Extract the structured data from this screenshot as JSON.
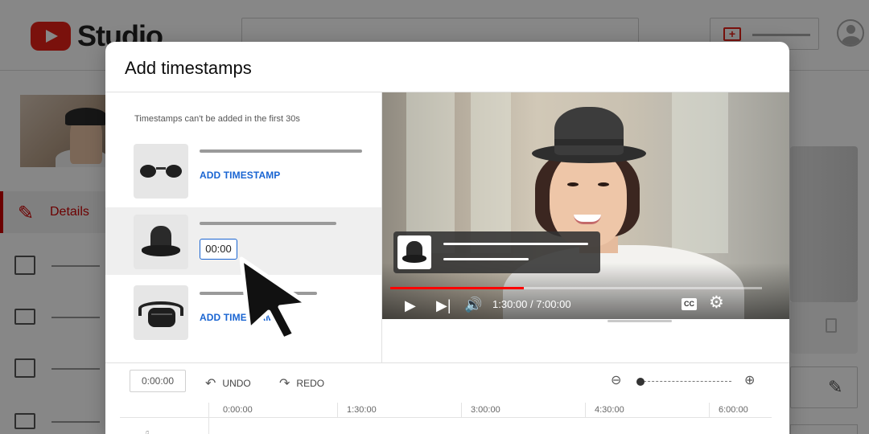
{
  "background_app": {
    "brand": "Studio",
    "nav": {
      "details_label": "Details"
    }
  },
  "modal": {
    "title": "Add timestamps",
    "hint": "Timestamps can't be added in the first 30s",
    "products": [
      {
        "icon": "sunglasses-icon",
        "action_label": "ADD TIMESTAMP"
      },
      {
        "icon": "bucket-hat-icon",
        "timestamp_value": "00:00"
      },
      {
        "icon": "waist-bag-icon",
        "action_label": "ADD TIMESTAMP"
      }
    ],
    "player": {
      "time_display": "1:30:00 / 7:00:00",
      "progress": 0.36,
      "cc_label": "CC"
    },
    "timeline": {
      "current_time": "0:00:00",
      "undo_label": "UNDO",
      "redo_label": "REDO",
      "ticks": [
        "0:00:00",
        "1:30:00",
        "3:00:00",
        "4:30:00",
        "6:00:00"
      ]
    }
  },
  "colors": {
    "accent_blue": "#1a65d2",
    "brand_red": "#e62117",
    "progress_red": "#ff0000"
  }
}
